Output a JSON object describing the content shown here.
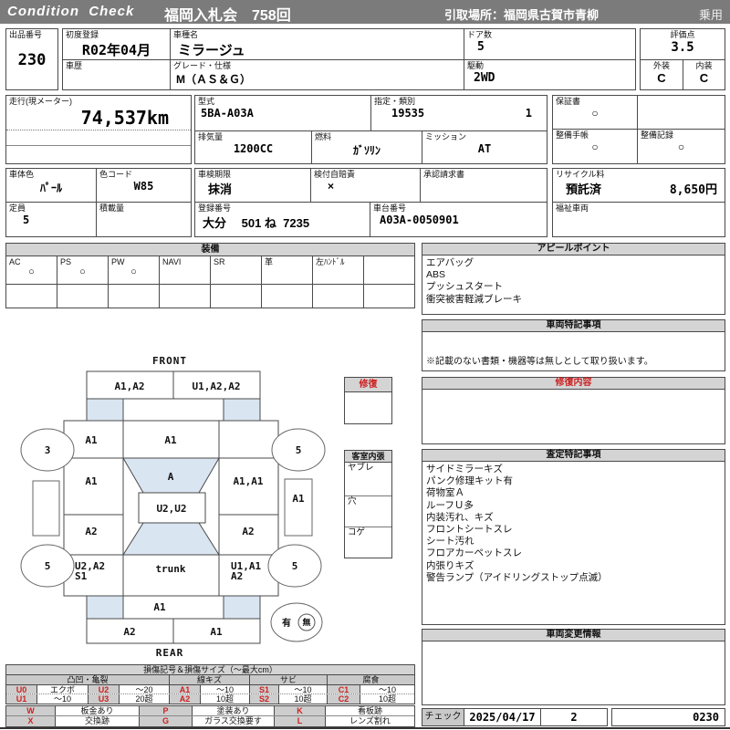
{
  "colors": {
    "header_bar": "#7b7b7b",
    "section_header_bg": "#d4d4d4",
    "accent_red": "#cc2222",
    "diagram_fill_blue": "#d9e5f1",
    "label_blue": "#2222cc"
  },
  "header": {
    "logo": "Condition  Check",
    "auction": "福岡入札会　758回",
    "pickup": "引取場所：福岡県古賀市青柳",
    "vehicle_class": "乗用"
  },
  "info": {
    "lot_label": "出品番号",
    "lot_value": "230",
    "first_reg_label": "初度登録",
    "first_reg_value": "R02年04月",
    "history_label": "車歴",
    "history_value": "",
    "model_label": "車種名",
    "model_value": "ミラージュ",
    "grade_label": "グレード・仕様",
    "grade_value": "M（ＡＳ＆Ｇ）",
    "doors_label": "ドア数",
    "doors_value": "5",
    "score_label": "評価点",
    "score_value": "3.5",
    "drive_label": "駆動",
    "drive_value": "2WD",
    "exterior_label": "外装",
    "exterior_value": "C",
    "interior_label": "内装",
    "interior_value": "C",
    "mileage_label": "走行(現メーター)",
    "mileage_value": "74,537km",
    "model_code_label": "型式",
    "model_code_value": "5BA-A03A",
    "class_label": "指定・類別",
    "class_value1": "19535",
    "class_value2": "1",
    "warranty_label": "保証書",
    "warranty_value": "○",
    "displacement_label": "排気量",
    "displacement_value": "1200CC",
    "fuel_label": "燃料",
    "fuel_value": "ｶﾞｿﾘﾝ",
    "transmission_label": "ミッション",
    "transmission_value": "AT",
    "maintenance_book_label": "整備手帳",
    "maintenance_book_value": "○",
    "maintenance_record_label": "整備記録",
    "maintenance_record_value": "○",
    "body_color_label": "車体色",
    "body_color_value": "ﾊﾟｰﾙ",
    "color_code_label": "色コード",
    "color_code_value": "W85",
    "inspection_label": "車検期限",
    "inspection_value": "抹消",
    "insurance_label": "検付自賠責",
    "insurance_value": "×",
    "approval_label": "承認請求書",
    "approval_value": "",
    "recycle_label": "リサイクル料",
    "recycle_status": "預託済",
    "recycle_fee": "8,650円",
    "capacity_label": "定員",
    "capacity_value": "5",
    "load_label": "積載量",
    "load_value": "",
    "plate_label": "登録番号",
    "plate_value": "大分　 501 ね  7235",
    "vin_label": "車台番号",
    "vin_value": "A03A-0050901",
    "welfare_label": "福祉車両",
    "welfare_value": ""
  },
  "equipment": {
    "title": "装備",
    "items": [
      {
        "label": "AC",
        "value": "○"
      },
      {
        "label": "PS",
        "value": "○"
      },
      {
        "label": "PW",
        "value": "○"
      },
      {
        "label": "NAVI",
        "value": ""
      },
      {
        "label": "SR",
        "value": ""
      },
      {
        "label": "革",
        "value": ""
      },
      {
        "label": "左ﾊﾝﾄﾞﾙ",
        "value": ""
      },
      {
        "label": "",
        "value": ""
      }
    ]
  },
  "appeal": {
    "title": "アピールポイント",
    "lines": [
      "エアバッグ",
      "ABS",
      "プッシュスタート",
      "衝突被害軽減ブレーキ"
    ]
  },
  "vehicle_notes": {
    "title": "車両特記事項",
    "note": "※記載のない書類・機器等は無しとして取り扱います。"
  },
  "repair_detail": {
    "title": "修復内容",
    "content": ""
  },
  "assessment": {
    "title": "査定特記事項",
    "lines": [
      "サイドミラーキズ",
      "パンク修理キット有",
      "荷物室Ａ",
      "ルーフＵ多",
      "内装汚れ、キズ",
      "フロントシートスレ",
      "シート汚れ",
      "フロアカーペットスレ",
      "内張りキズ",
      "警告ランプ（アイドリングストップ点滅）"
    ]
  },
  "changes": {
    "title": "車両変更情報",
    "content": ""
  },
  "check": {
    "label": "チェック",
    "date": "2025/04/17",
    "count": "2",
    "number": "0230"
  },
  "repair_box": {
    "title": "修復",
    "content": ""
  },
  "cabin": {
    "title": "客室内張",
    "rows": [
      "ヤブレ",
      "穴",
      "コゲ"
    ]
  },
  "diagram": {
    "front_label": "FRONT",
    "rear_label": "REAR",
    "trunk_label": "trunk",
    "front_bumper_left": "A1,A2",
    "front_bumper_right": "U1,A2,A2",
    "left_fender": "A1",
    "hood": "A1",
    "right_fender": "",
    "left_front_door": "A1",
    "windshield": "A",
    "roof": "U2,U2",
    "right_front_door": "A1,A1",
    "left_rear_door": "A2",
    "right_rear_door": "A2",
    "left_quarter_1": "U2,A2",
    "left_quarter_2": "S1",
    "right_quarter_1": "U1,A1",
    "right_quarter_2": "A2",
    "rear_panel": "A1",
    "rear_bumper_left": "A2",
    "rear_bumper_right": "A1",
    "right_sill": "A1",
    "tire_front_left": "3",
    "tire_front_right": "5",
    "tire_rear_left": "5",
    "tire_rear_right": "5",
    "spare_has": "有",
    "spare_none": "無"
  },
  "legend": {
    "title": "損傷記号＆損傷サイズ（～最大cm）",
    "groups": [
      "凸凹・亀裂",
      "線キズ",
      "サビ",
      "腐食"
    ],
    "cells_row1": [
      "U0",
      "エクボ",
      "U2",
      "～20",
      "A1",
      "～10",
      "S1",
      "～10",
      "C1",
      "～10"
    ],
    "cells_row2": [
      "U1",
      "～10",
      "U3",
      "20超",
      "A2",
      "10超",
      "S2",
      "10超",
      "C2",
      "10超"
    ],
    "marks_row1": [
      "W",
      "板金あり",
      "P",
      "塗装あり",
      "K",
      "看板跡"
    ],
    "marks_row2": [
      "X",
      "交換跡",
      "G",
      "ガラス交換要す",
      "L",
      "レンズ割れ"
    ]
  }
}
